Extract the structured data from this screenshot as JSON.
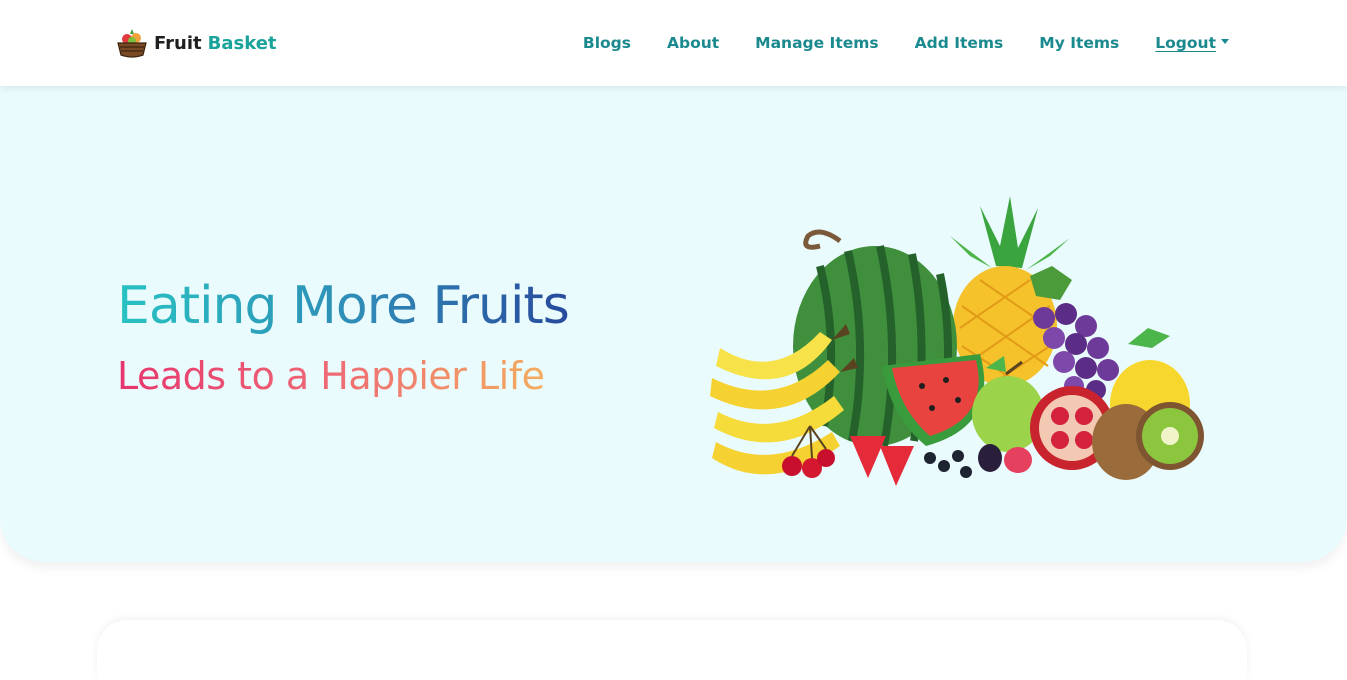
{
  "brand": {
    "name": "Fruit",
    "accent": "Basket",
    "icon": "fruit-basket-logo"
  },
  "nav": {
    "links": [
      "Blogs",
      "About",
      "Manage Items",
      "Add Items",
      "My Items"
    ],
    "logout_label": "Logout"
  },
  "hero": {
    "title": "Eating More Fruits",
    "subtitle": "Leads to a Happier Life",
    "illustration": "fruit-pile-illustration"
  },
  "colors": {
    "nav_link": "#1b8a8f",
    "brand_accent": "#1aa39a",
    "hero_bg": "#eafbfd",
    "title_gradient": [
      "#28c2c2",
      "#284a9d"
    ],
    "subtitle_gradient": [
      "#e7356e",
      "#f3ad5f"
    ]
  }
}
